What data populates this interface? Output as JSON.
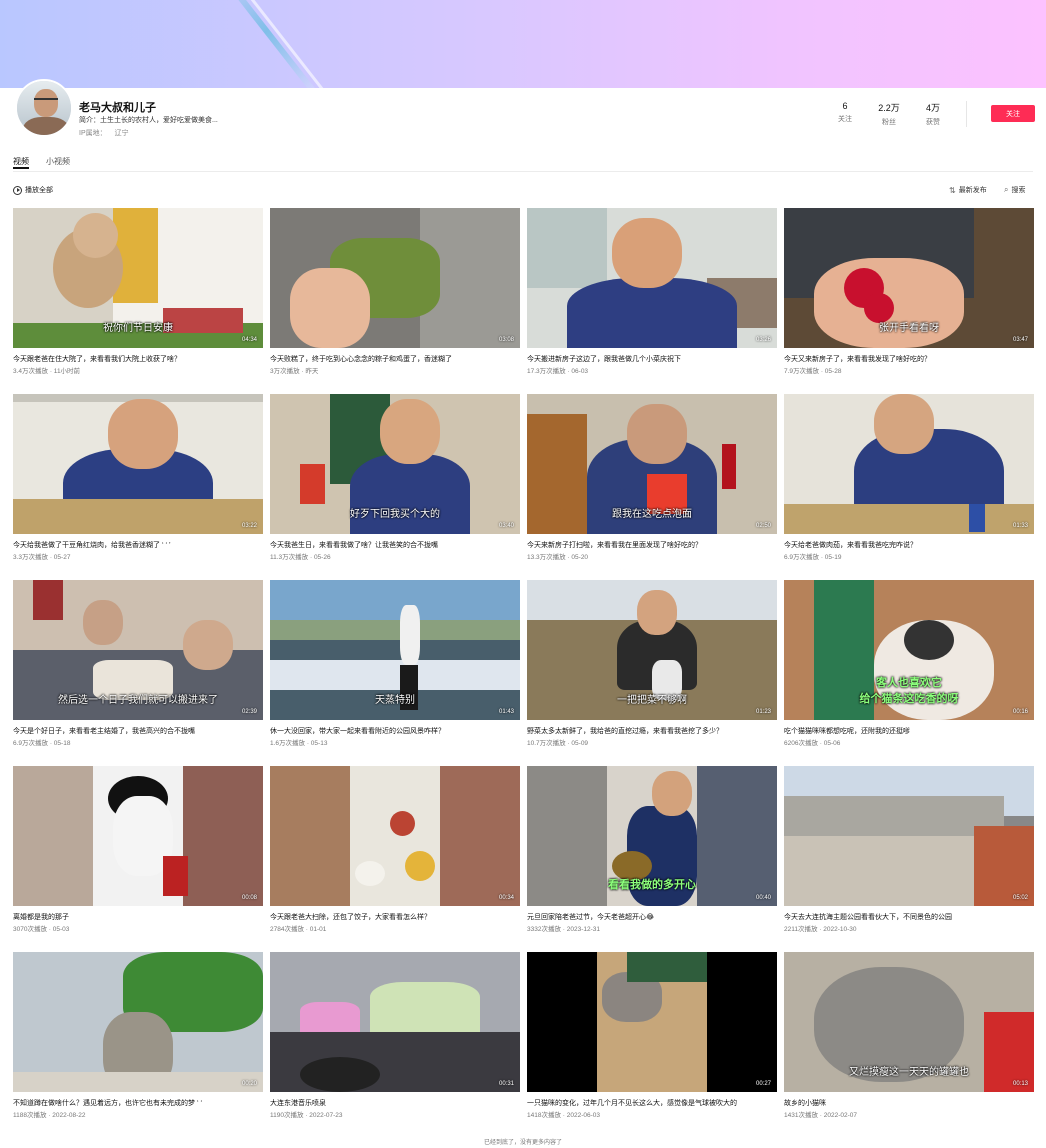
{
  "profile": {
    "name": "老马大叔和儿子",
    "bio": "简介：土生土长的农村人，爱好吃爱做美食...",
    "ip_label": "IP属地：",
    "ip_value": "辽宁"
  },
  "stats": [
    {
      "num": "6",
      "label": "关注"
    },
    {
      "num": "2.2万",
      "label": "粉丝"
    },
    {
      "num": "4万",
      "label": "获赞"
    }
  ],
  "follow_label": "关注",
  "tabs": [
    {
      "label": "视频",
      "active": true
    },
    {
      "label": "小视频",
      "active": false
    }
  ],
  "toolbar": {
    "play_all": "播放全部",
    "sort": "最新发布",
    "search": "搜索",
    "sort_icon": "sort-icon",
    "search_icon": "search-icon"
  },
  "videos": [
    {
      "title": "今天跟老爸在住大院了，来看看我们大院上收获了啥？",
      "meta": "3.4万次播放 · 11小时前",
      "duration": "04:34",
      "caption": "祝你们节日安康",
      "thumb": "kitchen"
    },
    {
      "title": "今天败糕了，终于吃到心心念念的粽子和鸡蛋了，香迷糊了",
      "meta": "3万次播放 · 昨天",
      "duration": "03:08",
      "caption": "",
      "thumb": "zongzi"
    },
    {
      "title": "今天搬进新房子这边了，跟我爸做几个小菜庆祝下",
      "meta": "17.3万次播放 · 06-03",
      "duration": "03:26",
      "caption": "",
      "thumb": "eating-blue"
    },
    {
      "title": "今天又来新房子了，来看看我发现了啥好吃的？",
      "meta": "7.9万次播放 · 05-28",
      "duration": "03:47",
      "caption": "张开手看看呀",
      "thumb": "strawberry"
    },
    {
      "title": "今天给我爸做了干豆角红烧肉，给我爸香迷糊了 ‘ ‘ ’",
      "meta": "3.3万次播放 · 05-27",
      "duration": "03:22",
      "caption": "",
      "thumb": "newspaper1"
    },
    {
      "title": "今天我爸生日，来看看我做了啥？让我爸笑的合不拢嘴",
      "meta": "11.3万次播放 · 05-26",
      "duration": "03:40",
      "caption": "好歹下回我买个大的",
      "thumb": "birthday"
    },
    {
      "title": "今天来新房子打扫啦，来看看我在里面发现了啥好吃的？",
      "meta": "13.3万次播放 · 05-20",
      "duration": "02:50",
      "caption": "跟我在这吃点泡面",
      "thumb": "noodles"
    },
    {
      "title": "今天给老爸做肉茄，来看看我爸吃完咋说？",
      "meta": "6.9万次播放 · 05-19",
      "duration": "01:33",
      "caption": "",
      "thumb": "newspaper2"
    },
    {
      "title": "今天是个好日子，来看看老主结婚了，我爸高兴的合不拢嘴",
      "meta": "6.9万次播放 · 05-18",
      "duration": "02:39",
      "caption": "然后选一个日子我们就可以搬进来了",
      "thumb": "dinner"
    },
    {
      "title": "休一大没回家，带大家一起来看看附近的公园风景咋样？",
      "meta": "1.6万次播放 · 05-13",
      "duration": "01:43",
      "caption": "天蒸特别",
      "thumb": "sea"
    },
    {
      "title": "野菜太多太新鲜了，我给爸的直挖过瘾，来看看我爸挖了多少？",
      "meta": "10.7万次播放 · 05-09",
      "duration": "01:23",
      "caption": "一把把菜不够啊",
      "thumb": "field"
    },
    {
      "title": "吃个猫猫咪咪都想吃呢，还附我的还挺嗲",
      "meta": "6206次播放 · 05-06",
      "duration": "00:16",
      "caption": "客人也喜欢它\n给个猫条这吃香的呀",
      "thumb": "cat-treat"
    },
    {
      "title": "离婚都是我的那子",
      "meta": "3070次播放 · 05-03",
      "duration": "00:08",
      "caption": "",
      "thumb": "dog"
    },
    {
      "title": "今天跟老爸大扫除，还包了饺子，大家看看怎么样？",
      "meta": "2784次播放 · 01-01",
      "duration": "00:34",
      "caption": "",
      "thumb": "dumplings"
    },
    {
      "title": "元旦回家陪老爸过节，今天老爸超开心😂",
      "meta": "3332次播放 · 2023-12-31",
      "duration": "00:40",
      "caption": "看看我做的多开心",
      "thumb": "dad-noodle"
    },
    {
      "title": "今天去大连抗海主题公园看看伙大下，不同景色的公园",
      "meta": "2211次播放 · 2022-10-30",
      "duration": "05:02",
      "caption": "",
      "thumb": "park"
    },
    {
      "title": "不知道蹲在做啥什么？遇见着远方，也许它也有未完成的梦 ‘ ‘",
      "meta": "1188次播放 · 2022-08-22",
      "duration": "00:20",
      "caption": "",
      "thumb": "cat-plant"
    },
    {
      "title": "大连东港音乐喷泉",
      "meta": "1190次播放 · 2022-07-23",
      "duration": "00:31",
      "caption": "",
      "thumb": "fountain"
    },
    {
      "title": "一只猫咪的变化，过年几个月不见长这么大，感觉像是气球被吹大的",
      "meta": "1418次播放 · 2022-06-03",
      "duration": "00:27",
      "caption": "",
      "thumb": "cat-small"
    },
    {
      "title": "故乡的小猫咪",
      "meta": "1431次播放 · 2022-02-07",
      "duration": "00:13",
      "caption": "又烂摸瘦这一天天的罐罐也",
      "thumb": "cat-sleep"
    }
  ],
  "footer": "已经到底了，没有更多内容了"
}
